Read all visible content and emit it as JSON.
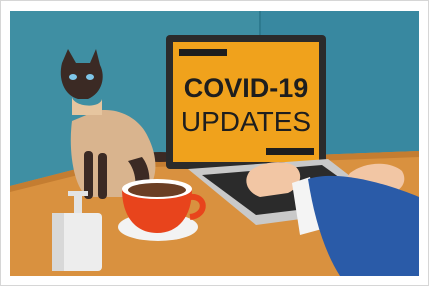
{
  "illustration": {
    "screen": {
      "line1": "COVID-19",
      "line2": "UPDATES"
    }
  },
  "colors": {
    "wall": "#3f8fa3",
    "wall_dark": "#2f7d92",
    "table": "#d9913f",
    "table_shadow": "#c47d31",
    "screen": "#f0a21c",
    "text": "#1e1e1e",
    "cup": "#e8441c",
    "sleeve": "#2a5ba8",
    "bottle": "#ededed",
    "cat_body": "#d9b48e",
    "cat_dark": "#3b2a24"
  }
}
